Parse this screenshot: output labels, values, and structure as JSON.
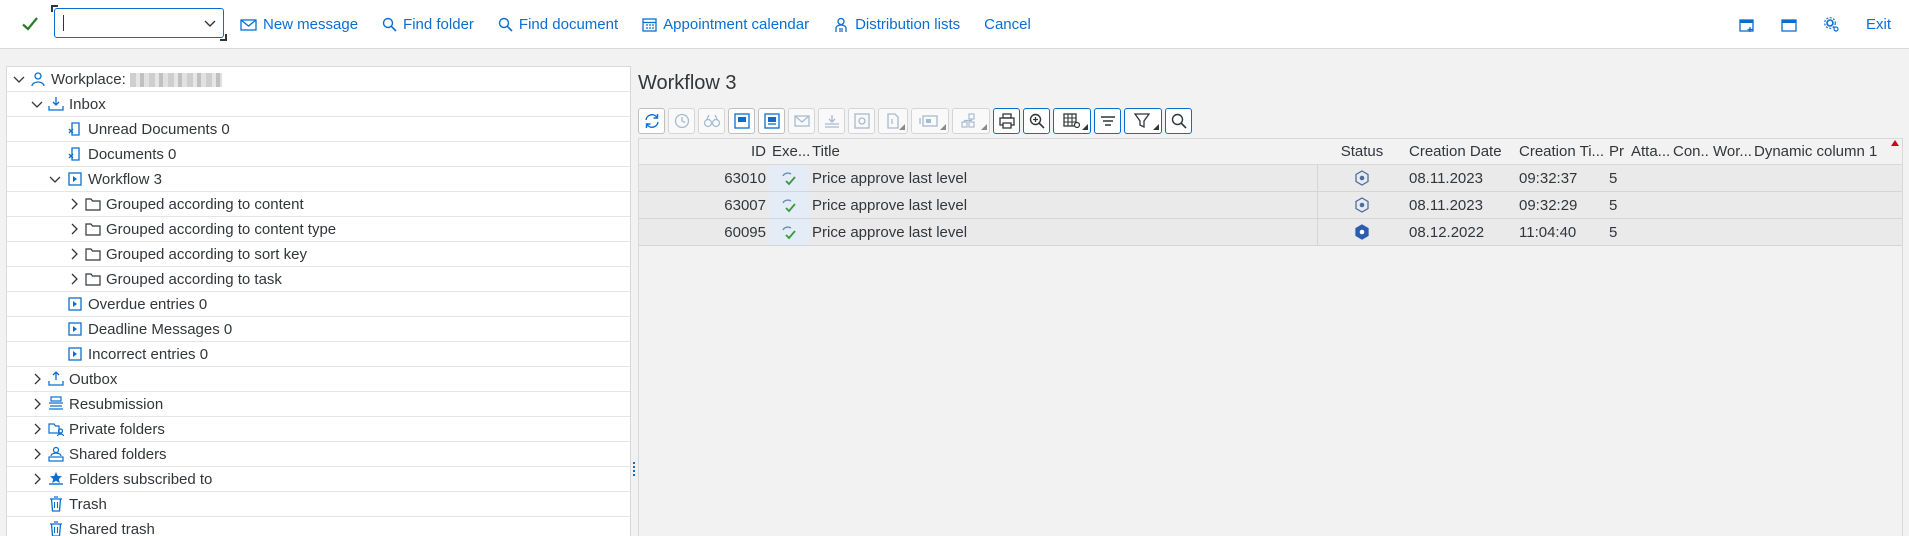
{
  "toolbar": {
    "command_value": "",
    "items": [
      {
        "label": "New message",
        "icon": "envelope-icon"
      },
      {
        "label": "Find folder",
        "icon": "search-icon"
      },
      {
        "label": "Find document",
        "icon": "search-icon"
      },
      {
        "label": "Appointment calendar",
        "icon": "calendar-icon"
      },
      {
        "label": "Distribution lists",
        "icon": "distribution-list-icon"
      },
      {
        "label": "Cancel",
        "icon": ""
      }
    ],
    "exit_label": "Exit"
  },
  "tree": {
    "workplace_label": "Workplace:",
    "items": [
      {
        "label": "Inbox"
      },
      {
        "label": "Unread Documents 0"
      },
      {
        "label": "Documents 0"
      },
      {
        "label": "Workflow 3"
      },
      {
        "label": "Grouped according to content"
      },
      {
        "label": "Grouped according to content type"
      },
      {
        "label": "Grouped according to sort key"
      },
      {
        "label": "Grouped according to task"
      },
      {
        "label": "Overdue entries 0"
      },
      {
        "label": "Deadline Messages 0"
      },
      {
        "label": "Incorrect entries 0"
      },
      {
        "label": "Outbox"
      },
      {
        "label": "Resubmission"
      },
      {
        "label": "Private folders"
      },
      {
        "label": "Shared folders"
      },
      {
        "label": "Folders subscribed to"
      },
      {
        "label": "Trash"
      },
      {
        "label": "Shared trash"
      }
    ]
  },
  "main": {
    "title": "Workflow 3",
    "columns": {
      "id": "ID",
      "exe": "Exe...",
      "title": "Title",
      "status": "Status",
      "creation_date": "Creation Date",
      "creation_time": "Creation Ti...",
      "priority": "Pr",
      "attachments": "Atta...",
      "con": "Con...",
      "wor": "Wor...",
      "dynamic": "Dynamic column 1"
    },
    "rows": [
      {
        "id": "63010",
        "title": "Price approve last level",
        "date": "08.11.2023",
        "time": "09:32:37",
        "priority": "5"
      },
      {
        "id": "63007",
        "title": "Price approve last level",
        "date": "08.11.2023",
        "time": "09:32:29",
        "priority": "5"
      },
      {
        "id": "60095",
        "title": "Price approve last level",
        "date": "08.12.2022",
        "time": "11:04:40",
        "priority": "5"
      }
    ]
  },
  "colors": {
    "accent": "#0a6ed1",
    "ok_green": "#2b7d2b",
    "exe_green": "#3a9a3a"
  }
}
